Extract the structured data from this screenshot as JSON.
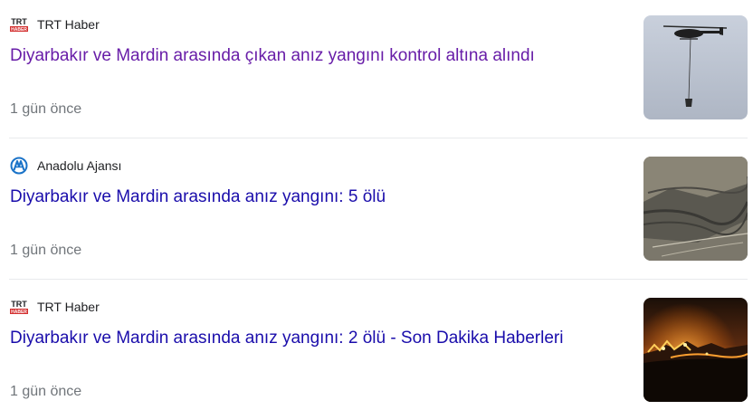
{
  "colors": {
    "visited_link": "#681da8",
    "link": "#1a0dab",
    "meta_text": "#70757a",
    "source_text": "#202124",
    "divider": "#e8eaed",
    "trt_red": "#d32f2f",
    "aa_blue": "#1a73c8"
  },
  "articles": [
    {
      "source": "TRT Haber",
      "source_logo": "trt-haber-logo",
      "logo_text": "TRT",
      "logo_subtext": "HABER",
      "title": "Diyarbakır ve Mardin arasında çıkan anız yangını kontrol altına alındı",
      "visited": true,
      "time": "1 gün önce",
      "thumbnail": "helicopter-water-bucket-image"
    },
    {
      "source": "Anadolu Ajansı",
      "source_logo": "anadolu-ajansi-logo",
      "title": "Diyarbakır ve Mardin arasında anız yangını: 5 ölü",
      "visited": false,
      "time": "1 gün önce",
      "thumbnail": "burnt-hillside-aerial-image"
    },
    {
      "source": "TRT Haber",
      "source_logo": "trt-haber-logo",
      "logo_text": "TRT",
      "logo_subtext": "HABER",
      "title": "Diyarbakır ve Mardin arasında anız yangını: 2 ölü - Son Dakika Haberleri",
      "visited": false,
      "time": "1 gün önce",
      "thumbnail": "night-wildfire-image"
    }
  ]
}
